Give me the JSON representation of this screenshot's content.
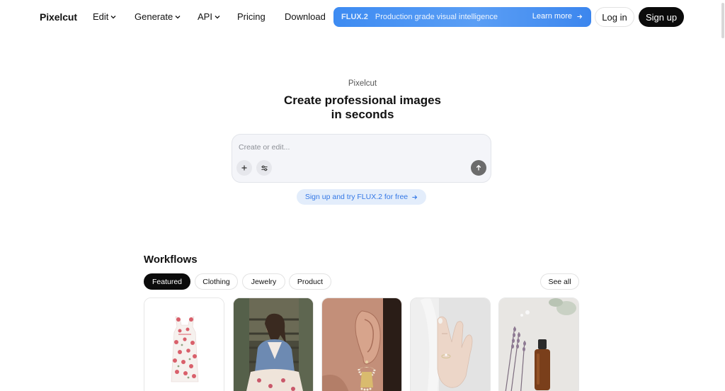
{
  "nav": {
    "logo": "Pixelcut",
    "items": [
      {
        "label": "Edit",
        "has_dropdown": true
      },
      {
        "label": "Generate",
        "has_dropdown": true
      },
      {
        "label": "API",
        "has_dropdown": true
      },
      {
        "label": "Pricing",
        "has_dropdown": false
      },
      {
        "label": "Download",
        "has_dropdown": false
      }
    ],
    "banner": {
      "tag": "FLUX.2",
      "text": "Production grade visual intelligence",
      "cta": "Learn more",
      "icon": "arrow-right-icon"
    },
    "login_label": "Log in",
    "signup_label": "Sign up"
  },
  "hero": {
    "eyebrow": "Pixelcut",
    "title_line1": "Create professional images",
    "title_line2": "in seconds",
    "prompt_placeholder": "Create or edit...",
    "add_icon": "plus-icon",
    "settings_icon": "sliders-icon",
    "send_icon": "arrow-up-icon",
    "try_cta": "Sign up and try FLUX.2 for free"
  },
  "workflows": {
    "title": "Workflows",
    "chips": [
      {
        "label": "Featured",
        "active": true
      },
      {
        "label": "Clothing",
        "active": false
      },
      {
        "label": "Jewelry",
        "active": false
      },
      {
        "label": "Product",
        "active": false
      }
    ],
    "see_all_label": "See all",
    "cards": [
      {
        "subject": "floral-dress"
      },
      {
        "subject": "woman-denim-jacket"
      },
      {
        "subject": "ear-with-earring"
      },
      {
        "subject": "hand-with-ring"
      },
      {
        "subject": "serum-bottle-lavender"
      }
    ]
  },
  "colors": {
    "accent_blue": "#4a94f3",
    "link_blue": "#3478e6",
    "pill_bg": "#e3edfb",
    "dark": "#0b0b0b"
  }
}
